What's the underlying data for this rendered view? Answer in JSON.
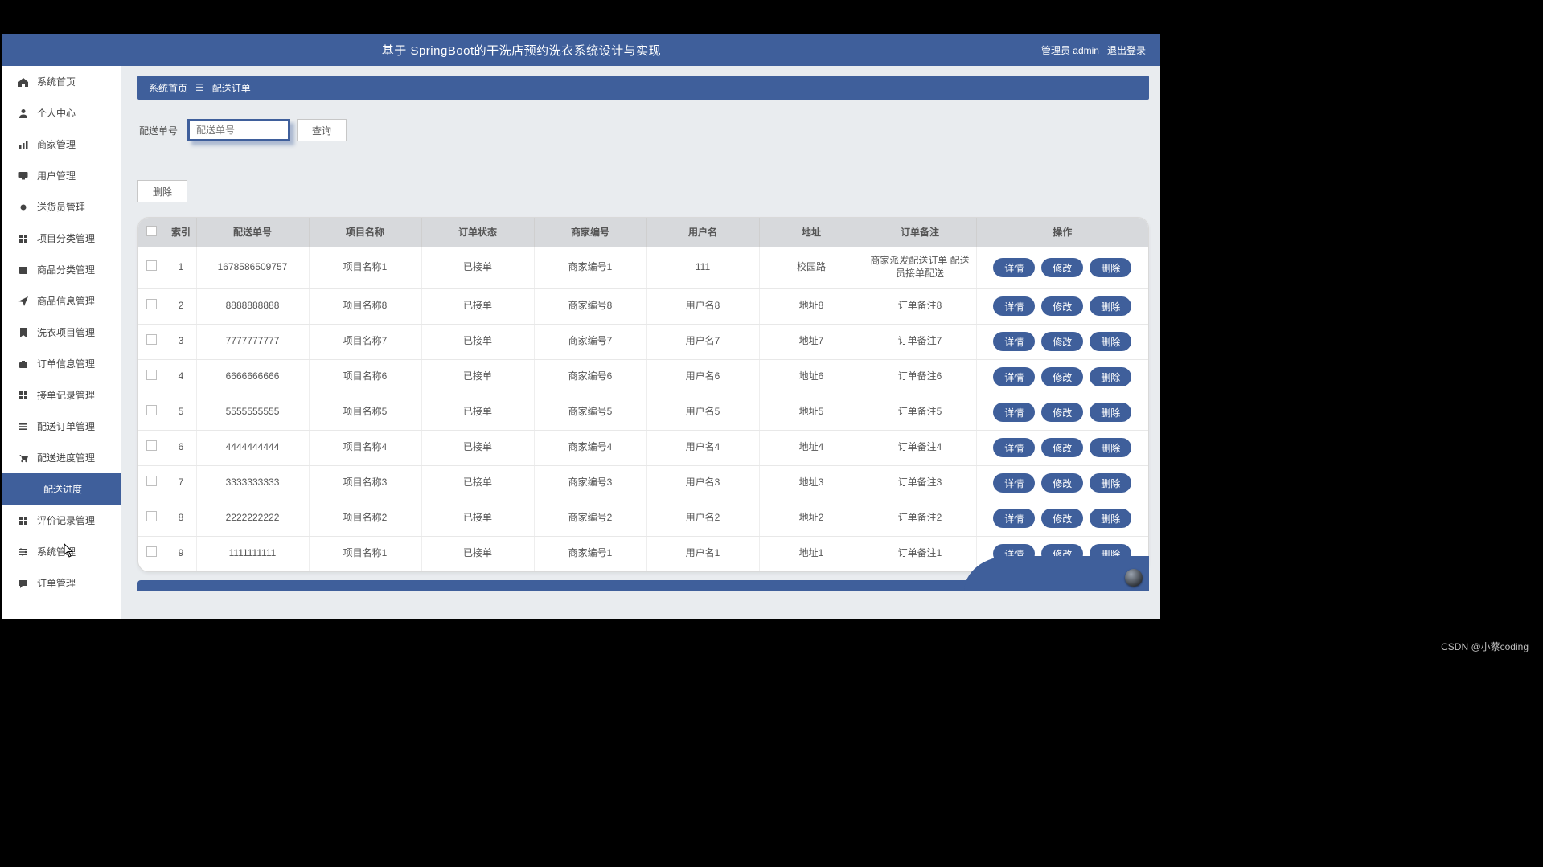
{
  "header": {
    "title": "基于 SpringBoot的干洗店预约洗衣系统设计与实现",
    "admin_label": "管理员 admin",
    "logout_label": "退出登录"
  },
  "sidebar": {
    "items": [
      {
        "label": "系统首页",
        "icon": "home"
      },
      {
        "label": "个人中心",
        "icon": "person"
      },
      {
        "label": "商家管理",
        "icon": "chart"
      },
      {
        "label": "用户管理",
        "icon": "monitor"
      },
      {
        "label": "送货员管理",
        "icon": "dot"
      },
      {
        "label": "项目分类管理",
        "icon": "grid"
      },
      {
        "label": "商品分类管理",
        "icon": "calendar"
      },
      {
        "label": "商品信息管理",
        "icon": "send"
      },
      {
        "label": "洗衣项目管理",
        "icon": "bookmark"
      },
      {
        "label": "订单信息管理",
        "icon": "briefcase"
      },
      {
        "label": "接单记录管理",
        "icon": "grid"
      },
      {
        "label": "配送订单管理",
        "icon": "list"
      },
      {
        "label": "配送进度管理",
        "icon": "cart"
      },
      {
        "label": "配送进度",
        "icon": "",
        "active": true,
        "indent": true
      },
      {
        "label": "评价记录管理",
        "icon": "grid"
      },
      {
        "label": "系统管理",
        "icon": "sliders"
      },
      {
        "label": "订单管理",
        "icon": "chat"
      }
    ]
  },
  "breadcrumb": {
    "root": "系统首页",
    "current": "配送订单"
  },
  "search": {
    "label": "配送单号",
    "placeholder": "配送单号",
    "query_btn": "查询"
  },
  "actions": {
    "delete_btn": "删除"
  },
  "table": {
    "headers": {
      "index": "索引",
      "order_no": "配送单号",
      "project": "项目名称",
      "status": "订单状态",
      "merchant": "商家编号",
      "user": "用户名",
      "addr": "地址",
      "remark": "订单备注",
      "ops": "操作"
    },
    "op_labels": {
      "detail": "详情",
      "edit": "修改",
      "delete": "删除"
    },
    "rows": [
      {
        "idx": "1",
        "order_no": "1678586509757",
        "project": "项目名称1",
        "status": "已接单",
        "merchant": "商家编号1",
        "user": "111",
        "addr": "校园路",
        "remark": "商家派发配送订单 配送员接单配送"
      },
      {
        "idx": "2",
        "order_no": "8888888888",
        "project": "项目名称8",
        "status": "已接单",
        "merchant": "商家编号8",
        "user": "用户名8",
        "addr": "地址8",
        "remark": "订单备注8"
      },
      {
        "idx": "3",
        "order_no": "7777777777",
        "project": "项目名称7",
        "status": "已接单",
        "merchant": "商家编号7",
        "user": "用户名7",
        "addr": "地址7",
        "remark": "订单备注7"
      },
      {
        "idx": "4",
        "order_no": "6666666666",
        "project": "项目名称6",
        "status": "已接单",
        "merchant": "商家编号6",
        "user": "用户名6",
        "addr": "地址6",
        "remark": "订单备注6"
      },
      {
        "idx": "5",
        "order_no": "5555555555",
        "project": "项目名称5",
        "status": "已接单",
        "merchant": "商家编号5",
        "user": "用户名5",
        "addr": "地址5",
        "remark": "订单备注5"
      },
      {
        "idx": "6",
        "order_no": "4444444444",
        "project": "项目名称4",
        "status": "已接单",
        "merchant": "商家编号4",
        "user": "用户名4",
        "addr": "地址4",
        "remark": "订单备注4"
      },
      {
        "idx": "7",
        "order_no": "3333333333",
        "project": "项目名称3",
        "status": "已接单",
        "merchant": "商家编号3",
        "user": "用户名3",
        "addr": "地址3",
        "remark": "订单备注3"
      },
      {
        "idx": "8",
        "order_no": "2222222222",
        "project": "项目名称2",
        "status": "已接单",
        "merchant": "商家编号2",
        "user": "用户名2",
        "addr": "地址2",
        "remark": "订单备注2"
      },
      {
        "idx": "9",
        "order_no": "1111111111",
        "project": "项目名称1",
        "status": "已接单",
        "merchant": "商家编号1",
        "user": "用户名1",
        "addr": "地址1",
        "remark": "订单备注1"
      }
    ]
  },
  "watermark": "CSDN @小蔡coding"
}
